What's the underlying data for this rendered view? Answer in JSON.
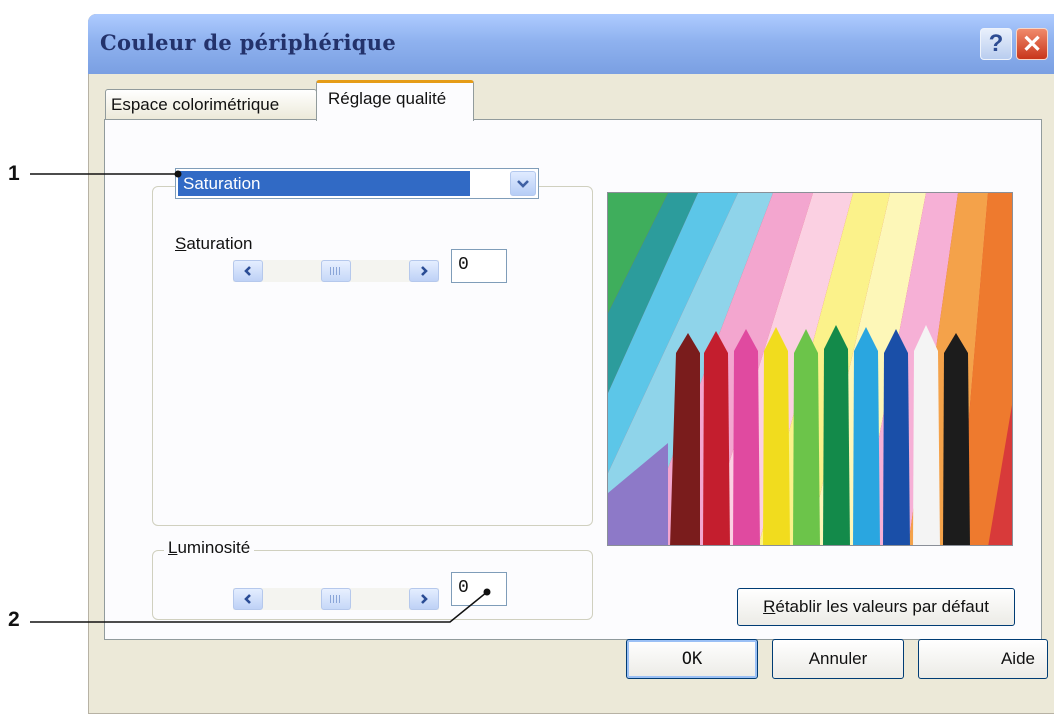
{
  "window": {
    "title": "Couleur de périphérique",
    "help_label": "?",
    "close_label": "✕"
  },
  "tabs": [
    {
      "label": "Espace colorimétrique",
      "active": false
    },
    {
      "label": "Réglage qualité",
      "active": true
    }
  ],
  "saturation_group": {
    "dropdown_value": "Saturation",
    "label_mnemonic": "S",
    "label_rest": "aturation",
    "value": "0",
    "slider_level": 0
  },
  "luminosity_group": {
    "label_mnemonic": "L",
    "label_rest": "uminosité",
    "value": "0",
    "slider_level": 0
  },
  "buttons": {
    "reset_mnemonic": "R",
    "reset_rest": "établir les valeurs par défaut",
    "ok": "OK",
    "cancel": "Annuler",
    "help": "Aide"
  },
  "callouts": [
    "1",
    "2"
  ],
  "colors": {
    "title_bar": "#7a9fe2",
    "selection": "#316ac5",
    "dialog_bg": "#ece9d8",
    "active_tab_accent": "#e59c18"
  },
  "icons": {
    "dropdown": "chevron-down-icon",
    "scroll_left": "chevron-left-icon",
    "scroll_right": "chevron-right-icon",
    "close": "close-icon",
    "help": "help-icon"
  }
}
